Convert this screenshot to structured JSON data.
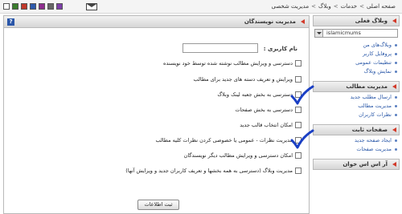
{
  "topbar": {
    "breadcrumbs": [
      "صفحه اصلی",
      "خدمات",
      "وبلاگ",
      "مدیریت شخصی"
    ],
    "separator": ">",
    "swatches": [
      "#ffffff",
      "#3a7d2c",
      "#c0392b",
      "#2e5aac",
      "#8e2d8e",
      "#666666",
      "#7c3fa8"
    ]
  },
  "sidebar": {
    "section_current_blog": "وبلاگ فعلی",
    "blog_select_value": "islamicmums",
    "current_blog_items": [
      "وبلاگ‌های من",
      "پروفایل کاربر",
      "تنظیمات عمومی",
      "نمایش وبلاگ"
    ],
    "section_manage_posts": "مدیریت مطالب",
    "manage_posts_items": [
      "ارسال مطلب جدید",
      "مدیریت مطالب",
      "نظرات کاربران"
    ],
    "section_static_pages": "صفحات ثابت",
    "static_pages_items": [
      "ایجاد صفحه جدید",
      "مدیریت صفحات"
    ],
    "section_rss": "آر اس اس خوان"
  },
  "main": {
    "title": "مدیریت نویسندگان",
    "help_label": "?",
    "username_label": "نام کاربری :",
    "username_value": "",
    "options": [
      {
        "label": "دسترسی و ویرایش مطالب نوشته شده توسط خود نویسنده",
        "checked": false
      },
      {
        "label": "ویرایش و تعریف دسته های جدید برای مطالب",
        "checked": false
      },
      {
        "label": "دسترسی به بخش جعبه لینک وبلاگ",
        "checked": true
      },
      {
        "label": "دسترسی به بخش صفحات",
        "checked": false
      },
      {
        "label": "امکان انتخاب قالب جدید",
        "checked": false
      },
      {
        "label": "مدیریت نظرات - عمومی یا خصوصی کردن نظرات کلیه مطالب",
        "checked": true
      },
      {
        "label": "امکان دسترسی و ویرایش مطالب دیگر نویسندگان",
        "checked": false
      },
      {
        "label": "مدیریت وبلاگ (دسترسی به همه بخشها و تعریف کاربران جدید و ویرایش آنها)",
        "checked": false
      }
    ],
    "submit_label": "ثبت اطلاعات"
  }
}
